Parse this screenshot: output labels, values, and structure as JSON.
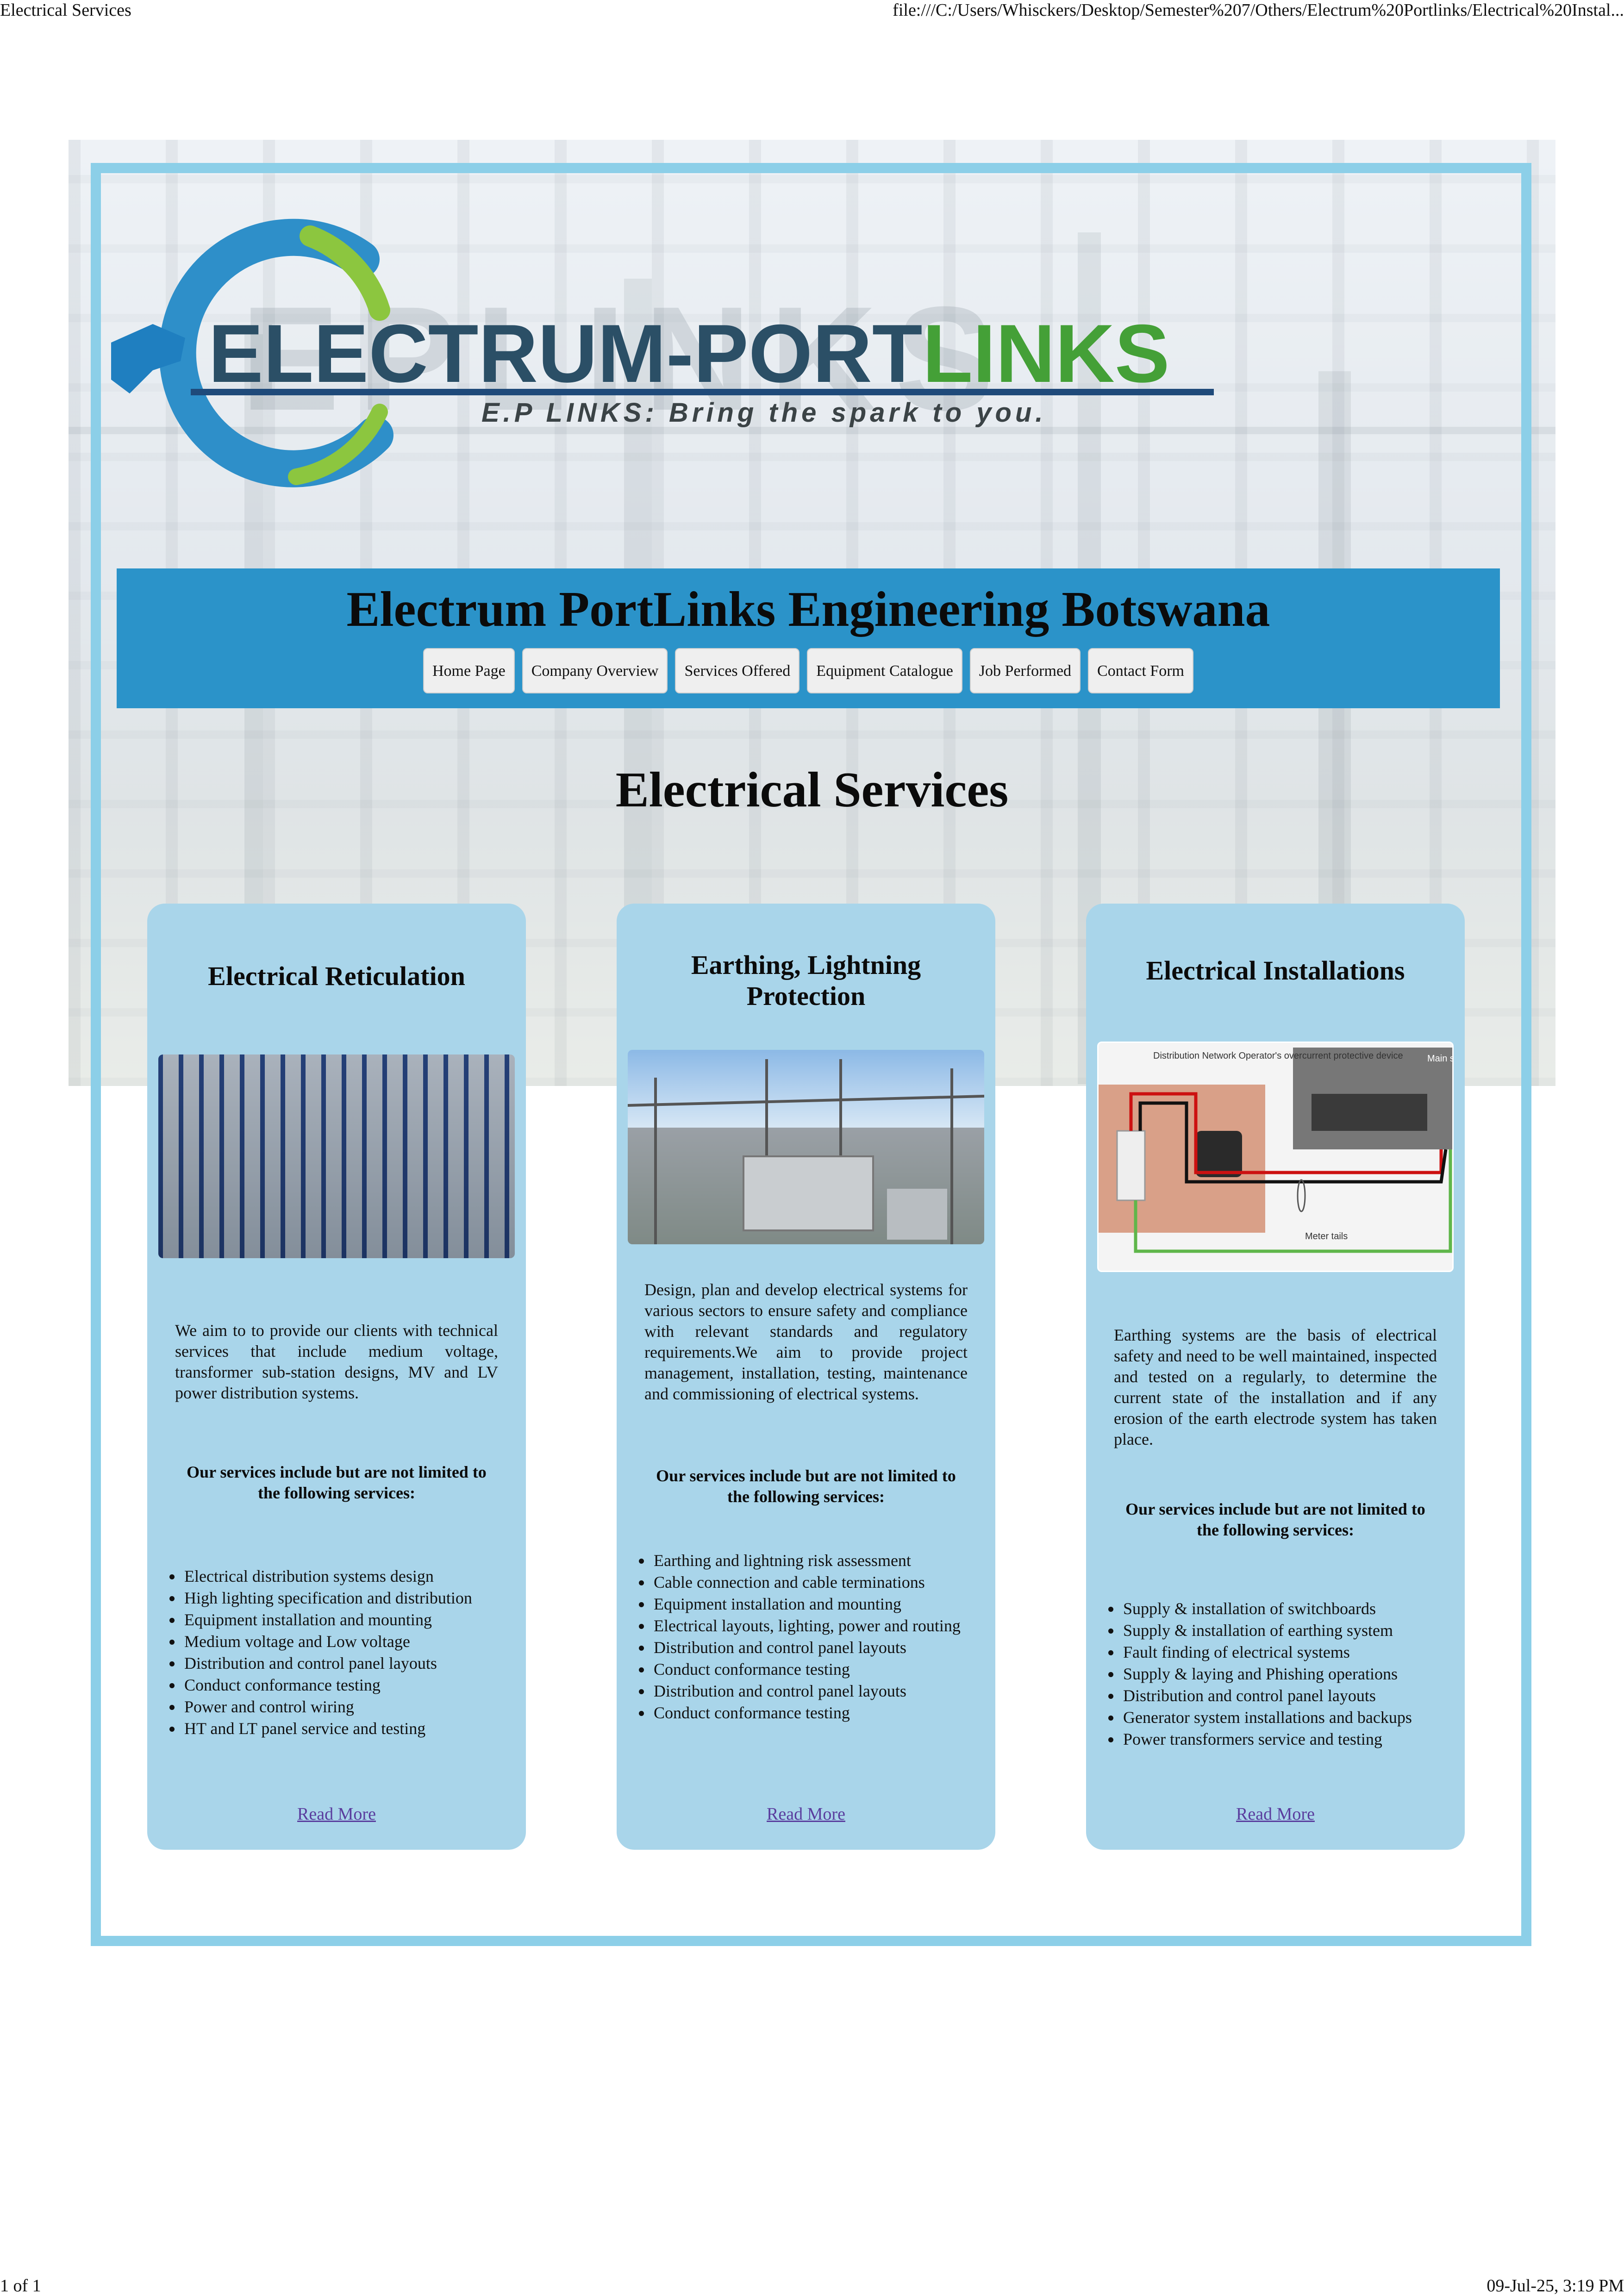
{
  "print": {
    "header_left": "Electrical Services",
    "header_right": "file:///C:/Users/Whisckers/Desktop/Semester%207/Others/Electrum%20Portlinks/Electrical%20Instal...",
    "footer_left": "1 of 1",
    "footer_right": "09-Jul-25, 3:19 PM"
  },
  "logo": {
    "ghost_text": "EPLINKS",
    "word_primary": "ELECTRUM-PORT",
    "word_secondary": "LINKS",
    "tagline": "E.P LINKS: Bring the spark to you.",
    "colors": {
      "primary": "#2b4f66",
      "secondary": "#44a037",
      "ring": "#2e8fc9"
    }
  },
  "banner": {
    "title": "Electrum PortLinks Engineering Botswana",
    "color": "#2b93c9",
    "nav": [
      {
        "label": "Home Page"
      },
      {
        "label": "Company Overview"
      },
      {
        "label": "Services Offered"
      },
      {
        "label": "Equipment Catalogue"
      },
      {
        "label": "Job Performed"
      },
      {
        "label": "Contact Form"
      }
    ]
  },
  "page_title": "Electrical Services",
  "cards": [
    {
      "title": "Electrical Reticulation",
      "image": "control-panel-photo",
      "description": "We aim to to provide our clients with technical services that include medium voltage, transformer sub-station designs, MV and LV power distribution systems.",
      "lead": "Our services include but are not limited to the following services:",
      "items": [
        "Electrical distribution systems design",
        "High lighting specification and distribution",
        "Equipment installation and mounting",
        "Medium voltage and Low voltage",
        "Distribution and control panel layouts",
        "Conduct conformance testing",
        "Power and control wiring",
        "HT and LT panel service and testing"
      ],
      "read_more": "Read More"
    },
    {
      "title": "Earthing, Lightning Protection",
      "image": "substation-transformer-photo",
      "description": "Design, plan and develop electrical systems for various sectors to ensure safety and compliance with relevant standards and regulatory requirements.We aim to provide project management, installation, testing, maintenance and commissioning of electrical systems.",
      "lead": "Our services include but are not limited to the following services:",
      "items": [
        "Earthing and lightning risk assessment",
        "Cable connection and cable terminations",
        "Equipment installation and mounting",
        "Electrical layouts, lighting, power and routing",
        "Distribution and control panel layouts",
        "Conduct conformance testing",
        "Distribution and control panel layouts",
        "Conduct conformance testing"
      ],
      "read_more": "Read More"
    },
    {
      "title": "Electrical Installations",
      "image": "meter-wiring-diagram",
      "diagram_labels": {
        "top": "Distribution Network Operator's overcurrent protective device",
        "right": "Main switch",
        "bottom": "Meter tails"
      },
      "description": "Earthing systems are the basis of electrical safety and need to be well maintained, inspected and tested on a regularly, to determine the current state of the installation and if any erosion of the earth electrode system has taken place.",
      "lead": "Our services include but are not limited to the following services:",
      "items": [
        "Supply & installation of switchboards",
        "Supply & installation of earthing system",
        "Fault finding of electrical systems",
        "Supply & laying and Phishing operations",
        "Distribution and control panel layouts",
        "Generator system installations and backups",
        "Power transformers service and testing"
      ],
      "read_more": "Read More"
    }
  ]
}
